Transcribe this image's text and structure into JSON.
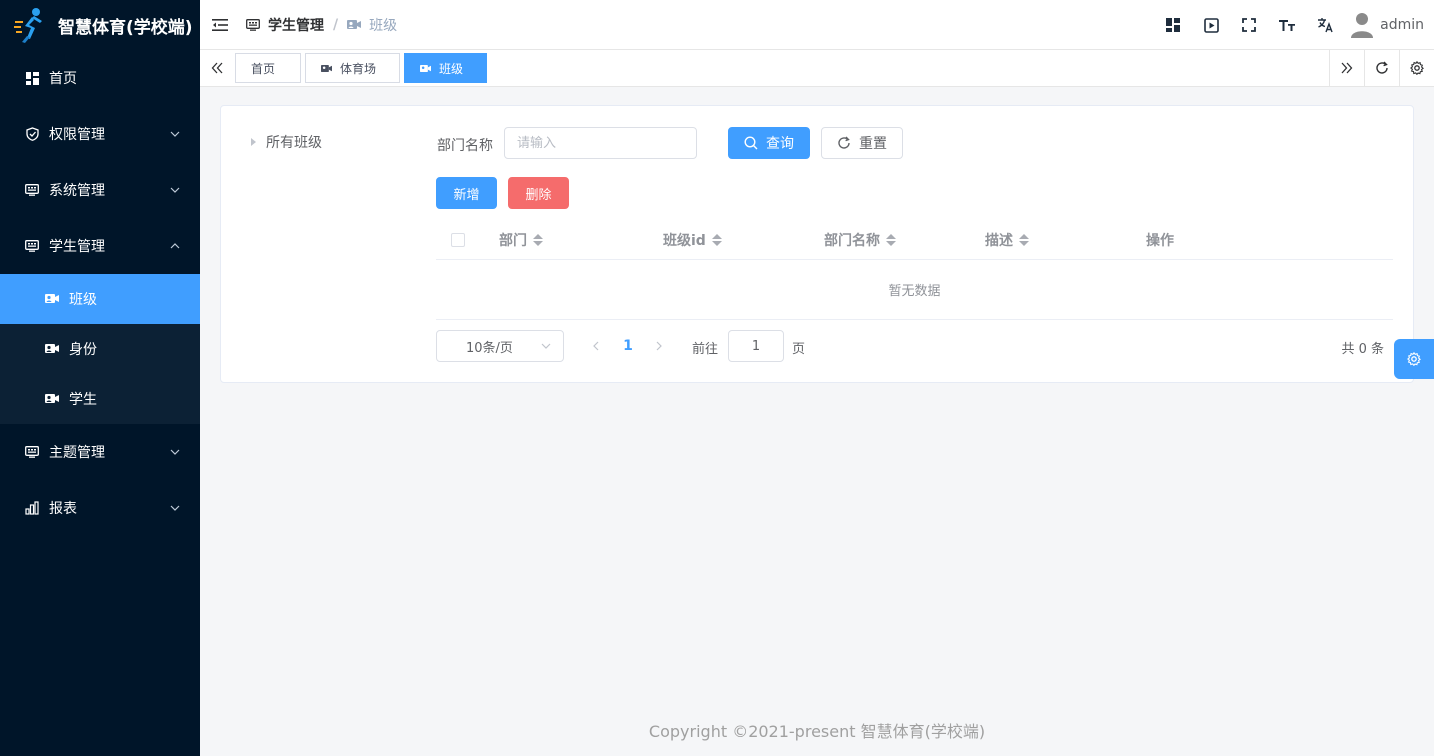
{
  "app": {
    "title": "智慧体育(学校端)"
  },
  "colors": {
    "accent": "#409eff",
    "danger": "#f56c6c",
    "sidebar_bg": "#001529",
    "submenu_bg": "#0c2135"
  },
  "sidebar": {
    "items": [
      {
        "label": "首页",
        "icon": "dashboard-icon"
      },
      {
        "label": "权限管理",
        "icon": "shield-icon",
        "expanded": false
      },
      {
        "label": "系统管理",
        "icon": "monitor-icon",
        "expanded": false
      },
      {
        "label": "学生管理",
        "icon": "monitor-icon",
        "expanded": true,
        "children": [
          {
            "label": "班级",
            "icon": "video-icon",
            "active": true
          },
          {
            "label": "身份",
            "icon": "video-icon",
            "active": false
          },
          {
            "label": "学生",
            "icon": "video-icon",
            "active": false
          }
        ]
      },
      {
        "label": "主题管理",
        "icon": "monitor-icon",
        "expanded": false
      },
      {
        "label": "报表",
        "icon": "bar-chart-icon",
        "expanded": false
      }
    ]
  },
  "header": {
    "breadcrumb": [
      {
        "label": "学生管理",
        "icon": "monitor-icon"
      },
      {
        "label": "班级",
        "icon": "video-icon"
      }
    ],
    "separator": "/",
    "icons": [
      "layout-icon",
      "play-icon",
      "fullscreen-icon",
      "font-size-icon",
      "translate-icon"
    ],
    "username": "admin"
  },
  "tags": [
    {
      "label": "首页",
      "active": false
    },
    {
      "label": "体育场",
      "icon": "video-icon",
      "active": false
    },
    {
      "label": "班级",
      "icon": "video-icon",
      "active": true
    }
  ],
  "tree": {
    "root_label": "所有班级"
  },
  "search": {
    "label": "部门名称",
    "placeholder": "请输入",
    "search_button": "查询",
    "reset_button": "重置"
  },
  "actions": {
    "add_button": "新增",
    "delete_button": "删除"
  },
  "table": {
    "columns": [
      "部门",
      "班级id",
      "部门名称",
      "描述",
      "操作"
    ],
    "empty_text": "暂无数据"
  },
  "pagination": {
    "page_size": "10条/页",
    "current_page": "1",
    "goto_label": "前往",
    "goto_value": "1",
    "goto_suffix": "页",
    "total": "共 0 条"
  },
  "footer": {
    "copyright": "Copyright ©2021-present 智慧体育(学校端)"
  }
}
